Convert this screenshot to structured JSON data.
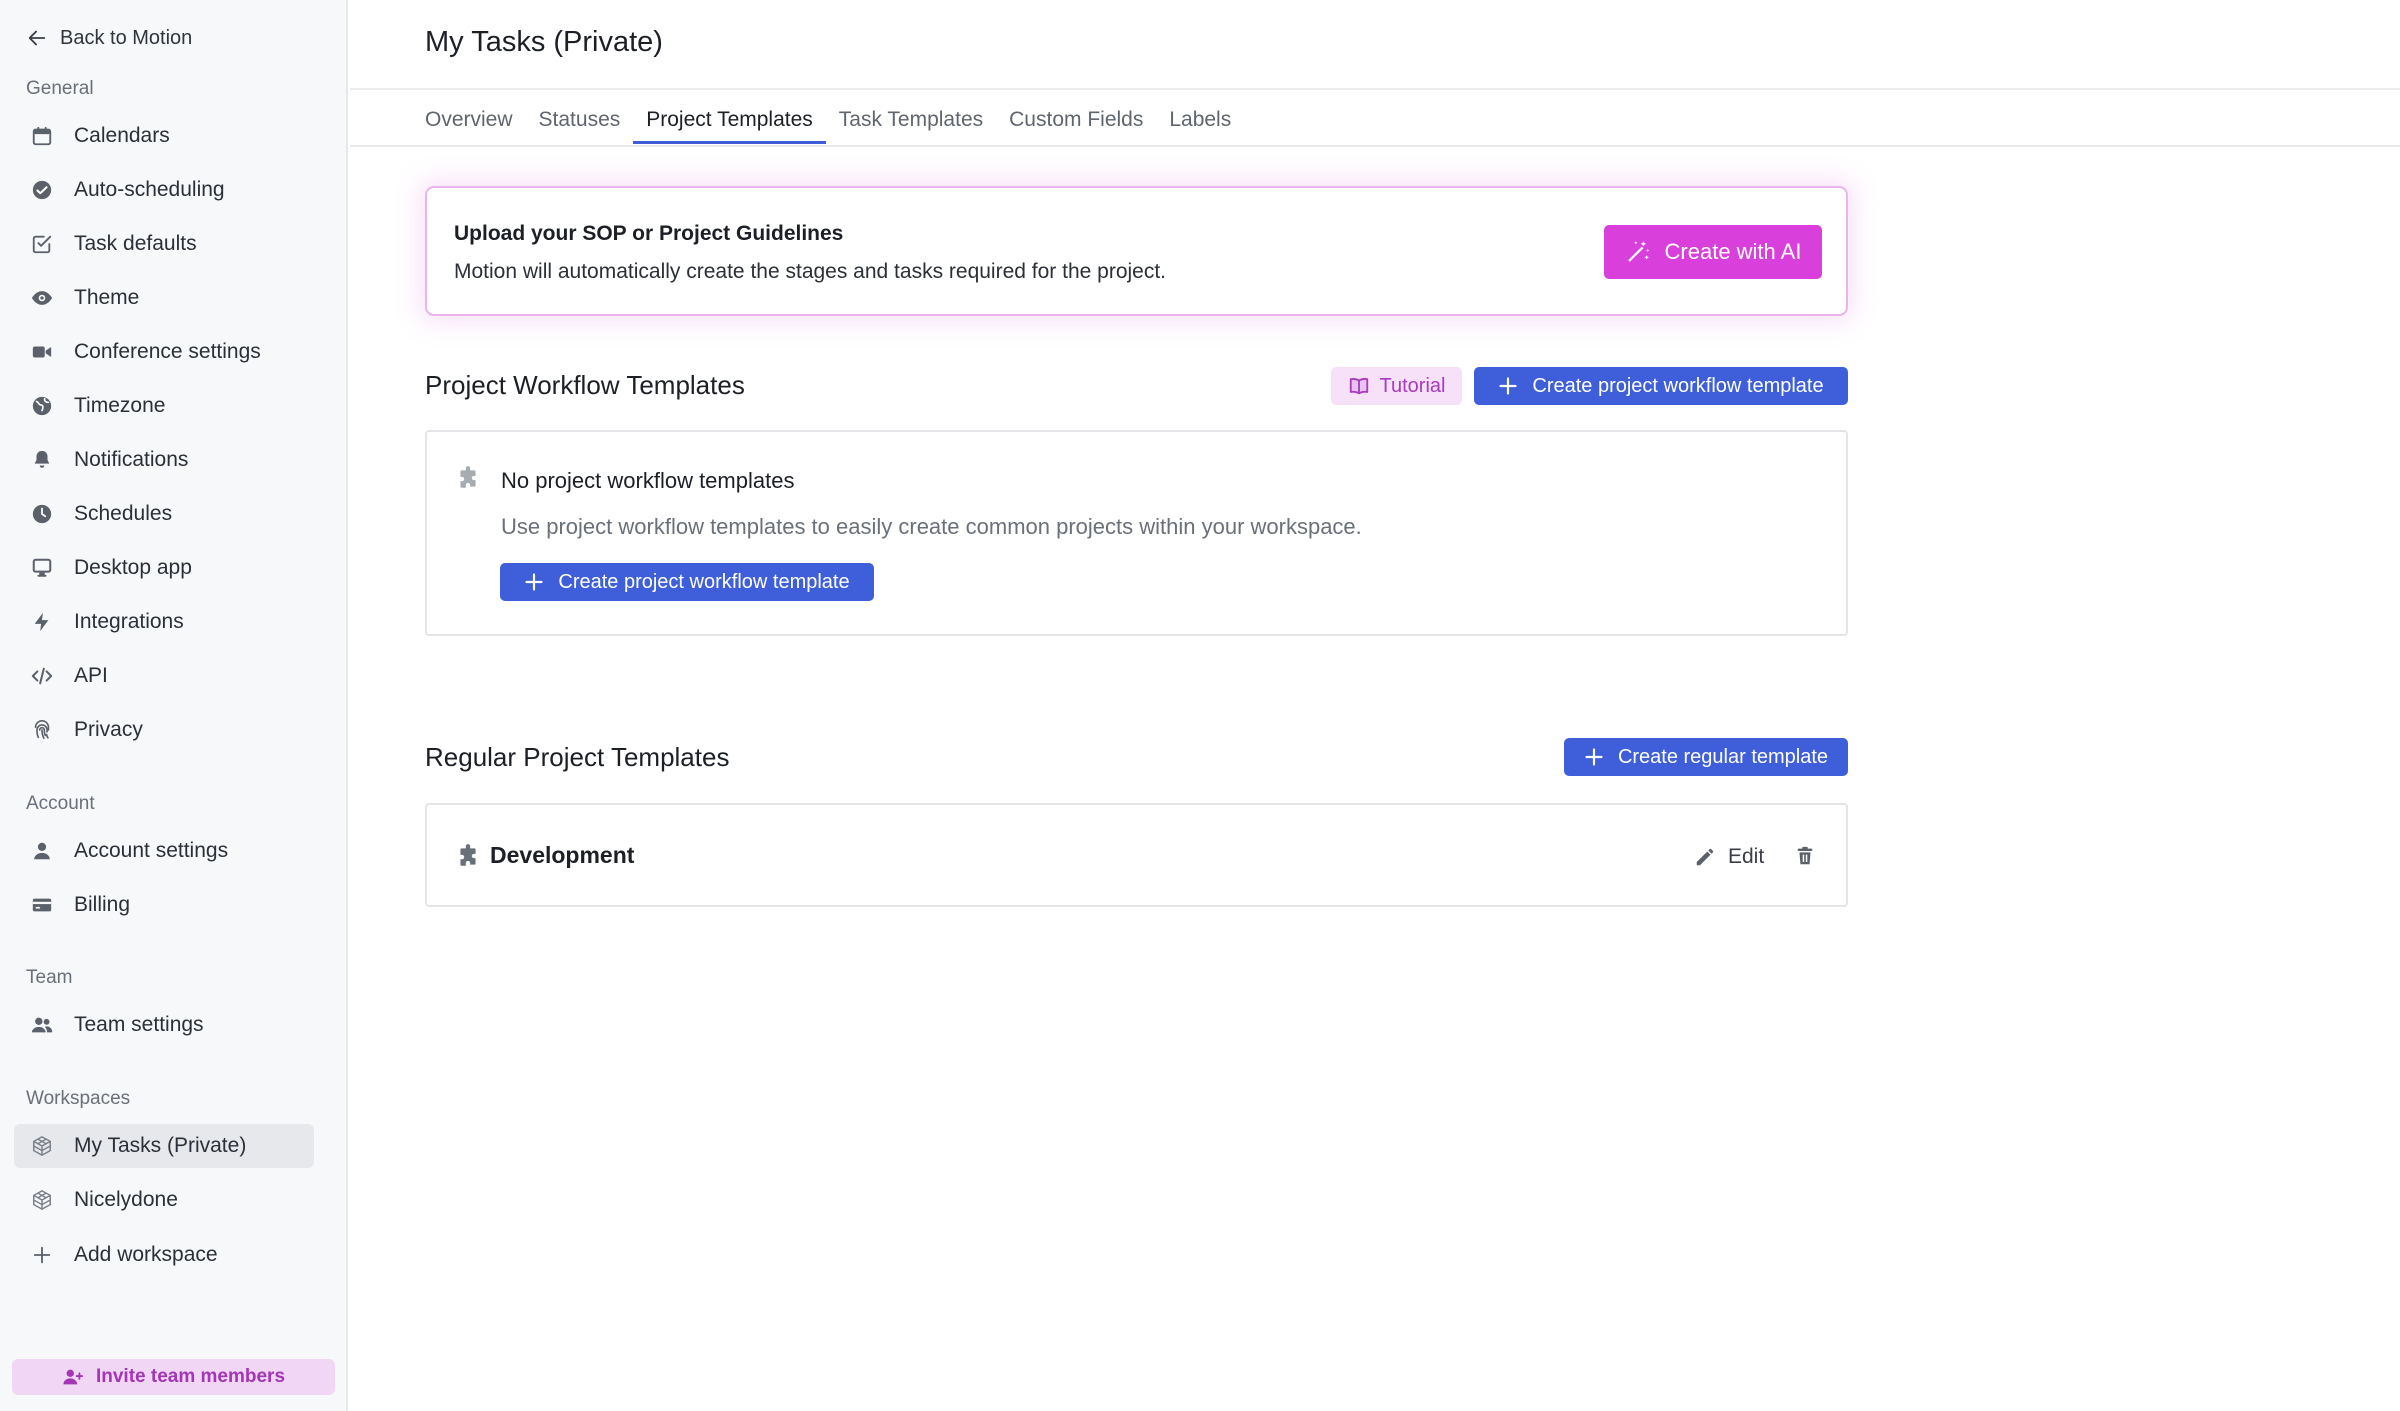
{
  "sidebar": {
    "back_label": "Back to Motion",
    "general_label": "General",
    "general_items": [
      {
        "label": "Calendars",
        "icon": "calendar-icon"
      },
      {
        "label": "Auto-scheduling",
        "icon": "check-circle-icon"
      },
      {
        "label": "Task defaults",
        "icon": "task-check-icon"
      },
      {
        "label": "Theme",
        "icon": "eye-icon"
      },
      {
        "label": "Conference settings",
        "icon": "video-icon"
      },
      {
        "label": "Timezone",
        "icon": "globe-icon"
      },
      {
        "label": "Notifications",
        "icon": "bell-icon"
      },
      {
        "label": "Schedules",
        "icon": "clock-icon"
      },
      {
        "label": "Desktop app",
        "icon": "monitor-icon"
      },
      {
        "label": "Integrations",
        "icon": "bolt-icon"
      },
      {
        "label": "API",
        "icon": "code-icon"
      },
      {
        "label": "Privacy",
        "icon": "fingerprint-icon"
      }
    ],
    "account_label": "Account",
    "account_items": [
      {
        "label": "Account settings",
        "icon": "user-icon"
      },
      {
        "label": "Billing",
        "icon": "credit-card-icon"
      }
    ],
    "team_label": "Team",
    "team_items": [
      {
        "label": "Team settings",
        "icon": "users-icon"
      }
    ],
    "workspaces_label": "Workspaces",
    "workspace_items": [
      {
        "label": "My Tasks (Private)",
        "icon": "cube-icon",
        "active": true
      },
      {
        "label": "Nicelydone",
        "icon": "cube-icon"
      }
    ],
    "add_workspace_label": "Add workspace",
    "invite_label": "Invite team members"
  },
  "header": {
    "title": "My Tasks (Private)"
  },
  "tabs": [
    {
      "label": "Overview"
    },
    {
      "label": "Statuses"
    },
    {
      "label": "Project Templates",
      "active": true
    },
    {
      "label": "Task Templates"
    },
    {
      "label": "Custom Fields"
    },
    {
      "label": "Labels"
    }
  ],
  "ai_card": {
    "title": "Upload your SOP or Project Guidelines",
    "description": "Motion will automatically create the stages and tasks required for the project.",
    "button_label": "Create with AI"
  },
  "workflow_section": {
    "title": "Project Workflow Templates",
    "tutorial_label": "Tutorial",
    "create_label": "Create project workflow template",
    "empty_title": "No project workflow templates",
    "empty_description": "Use project workflow templates to easily create common projects within your workspace.",
    "empty_button_label": "Create project workflow template"
  },
  "regular_section": {
    "title": "Regular Project Templates",
    "create_label": "Create regular template",
    "templates": [
      {
        "name": "Development",
        "edit_label": "Edit"
      }
    ]
  },
  "colors": {
    "accent_blue": "#3f5fda",
    "accent_magenta": "#d83fdb",
    "invite_bg": "#f1d6f5"
  }
}
